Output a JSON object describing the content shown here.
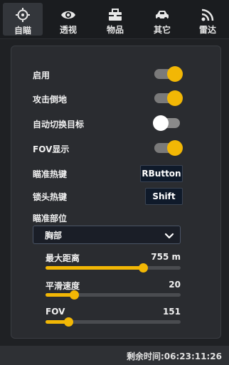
{
  "tabs": [
    {
      "label": "自瞄",
      "icon": "crosshair-icon",
      "active": true
    },
    {
      "label": "透视",
      "icon": "eye-icon",
      "active": false
    },
    {
      "label": "物品",
      "icon": "toolbox-icon",
      "active": false
    },
    {
      "label": "其它",
      "icon": "car-icon",
      "active": false
    },
    {
      "label": "雷达",
      "icon": "rss-icon",
      "active": false
    }
  ],
  "settings": {
    "enable": {
      "label": "启用",
      "on": true
    },
    "attack_downed": {
      "label": "攻击倒地",
      "on": true
    },
    "auto_switch_target": {
      "label": "自动切换目标",
      "on": false
    },
    "fov_display": {
      "label": "FOV显示",
      "on": true
    },
    "aim_hotkey": {
      "label": "瞄准热键",
      "value": "RButton"
    },
    "lock_hotkey": {
      "label": "锁头热键",
      "value": "Shift"
    },
    "aim_part": {
      "label": "瞄准部位",
      "value": "胸部"
    }
  },
  "sliders": [
    {
      "label": "最大距离",
      "value_text": "755 m",
      "fraction": 0.72
    },
    {
      "label": "平滑速度",
      "value_text": "20",
      "fraction": 0.21
    },
    {
      "label": "FOV",
      "value_text": "151",
      "fraction": 0.17
    }
  ],
  "footer": {
    "remaining_time": "剩余时间:06:23:11:26"
  },
  "colors": {
    "accent": "#f2b705",
    "background": "#1f2124",
    "panel": "#2a2c30"
  }
}
